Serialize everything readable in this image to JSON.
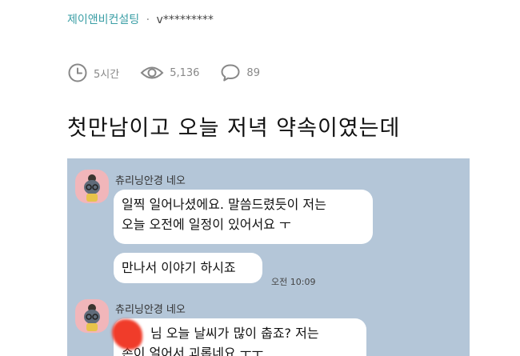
{
  "post": {
    "company": "제이앤비컨설팅",
    "separator": "·",
    "user": "v*********",
    "time_ago": "5시간",
    "views": "5,136",
    "comments": "89",
    "title": "첫만남이고 오늘 저녁 약속이였는데"
  },
  "chat": {
    "messages": [
      {
        "sender": "츄리닝안경 네오",
        "lines": [
          "일찍 일어나셨에요. 말씀드렸듯이 저는",
          "오늘 오전에 일정이 있어서요 ㅜ"
        ]
      },
      {
        "lines": [
          "만나서 이야기 하시죠"
        ],
        "time": "오전 10:09"
      },
      {
        "sender": "츄리닝안경 네오",
        "lines": [
          "님 오늘 날씨가 많이 춥죠? 저는",
          "손이 얼어서 괴롭네요 ㅜㅜ"
        ]
      }
    ]
  },
  "icons": [
    "clock-icon",
    "eye-icon",
    "comment-icon"
  ],
  "colors": {
    "company": "#3a9ea5",
    "chat_bg": "#b4c6d8",
    "avatar_bg": "#f1b6ba",
    "redaction": "#f03c2a"
  }
}
